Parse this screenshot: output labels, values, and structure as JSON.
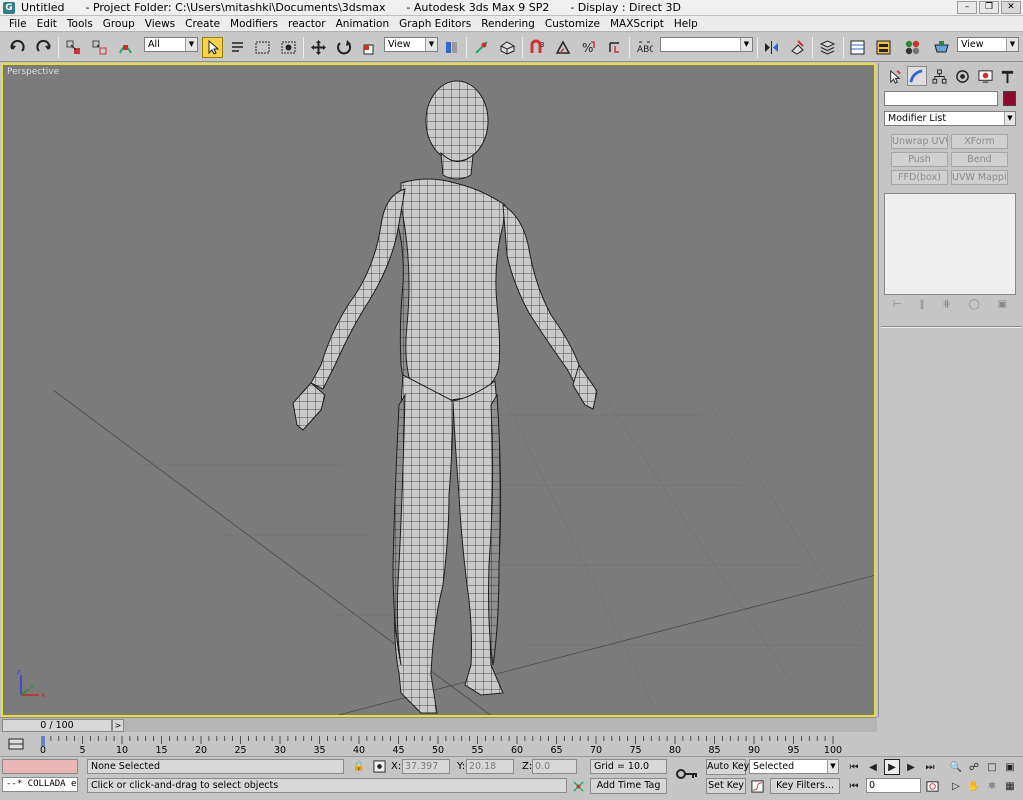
{
  "window": {
    "title": "Untitled      - Project Folder: C:\\Users\\mitashki\\Documents\\3dsmax      - Autodesk 3ds Max 9 SP2      - Display : Direct 3D",
    "controls": [
      "minimize-icon",
      "restore-icon",
      "close-icon"
    ]
  },
  "menu": [
    "File",
    "Edit",
    "Tools",
    "Group",
    "Views",
    "Create",
    "Modifiers",
    "reactor",
    "Animation",
    "Graph Editors",
    "Rendering",
    "Customize",
    "MAXScript",
    "Help"
  ],
  "toolbar": {
    "selection_filter": "All",
    "reference_coord": "View",
    "named_selection": "",
    "render_view": "View"
  },
  "viewport": {
    "label": "Perspective",
    "axis_labels": {
      "x": "x",
      "y": "y",
      "z": "z"
    }
  },
  "command_panel": {
    "tabs": [
      "create-tab",
      "modify-tab",
      "hierarchy-tab",
      "motion-tab",
      "display-tab",
      "utilities-tab"
    ],
    "object_name": "",
    "object_color": "#8c0b2d",
    "modifier_list": "Modifier List",
    "modifier_buttons": [
      "Unwrap UVW",
      "XForm",
      "Push",
      "Bend",
      "FFD(box)",
      "UVW Mapping C"
    ]
  },
  "time": {
    "slider": "0 / 100",
    "next_label": ">",
    "ticks": [
      "0",
      "5",
      "10",
      "15",
      "20",
      "25",
      "30",
      "35",
      "40",
      "45",
      "50",
      "55",
      "60",
      "65",
      "70",
      "75",
      "80",
      "85",
      "90",
      "95",
      "100"
    ]
  },
  "status": {
    "listener": "--* COLLADA e",
    "selection": "None Selected",
    "prompt": "Click or click-and-drag to select objects",
    "coord_x_label": "X:",
    "coord_x": "37.397",
    "coord_y_label": "Y:",
    "coord_y": "20.18",
    "coord_z_label": "Z:",
    "coord_z": "0.0",
    "grid": "Grid = 10.0",
    "add_time_tag": "Add Time Tag",
    "auto_key": "Auto Key",
    "set_key": "Set Key",
    "key_mode": "Selected",
    "key_filters": "Key Filters...",
    "current_frame": "0"
  }
}
